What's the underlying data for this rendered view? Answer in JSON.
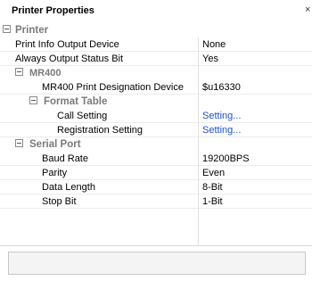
{
  "window": {
    "title": "Printer Properties",
    "close_glyph": "×"
  },
  "grid": {
    "printer": {
      "label": "Printer",
      "props": [
        {
          "name": "Print Info Output Device",
          "value": "None"
        },
        {
          "name": "Always Output Status Bit",
          "value": "Yes"
        }
      ]
    },
    "mr400": {
      "label": "MR400",
      "props": [
        {
          "name": "MR400 Print Designation Device",
          "value": "$u16330"
        }
      ]
    },
    "format_table": {
      "label": "Format Table",
      "props": [
        {
          "name": "Call Setting",
          "value": "Setting..."
        },
        {
          "name": "Registration Setting",
          "value": "Setting..."
        }
      ]
    },
    "serial_port": {
      "label": "Serial Port",
      "props": [
        {
          "name": "Baud Rate",
          "value": "19200BPS"
        },
        {
          "name": "Parity",
          "value": "Even"
        },
        {
          "name": "Data Length",
          "value": "8-Bit"
        },
        {
          "name": "Stop Bit",
          "value": "1-Bit"
        }
      ]
    }
  },
  "description": ""
}
